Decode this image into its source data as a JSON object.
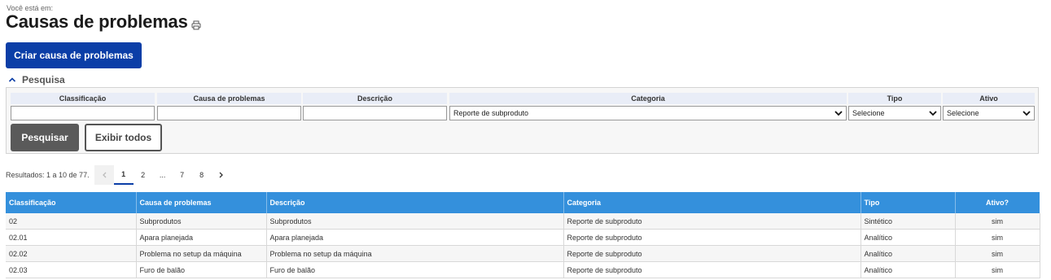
{
  "breadcrumb": {
    "label": "Você está em:"
  },
  "page": {
    "title": "Causas de problemas"
  },
  "actions": {
    "create_label": "Criar causa de problemas"
  },
  "search": {
    "title": "Pesquisa",
    "columns": [
      {
        "label": "Classificação",
        "value": ""
      },
      {
        "label": "Causa de problemas",
        "value": ""
      },
      {
        "label": "Descrição",
        "value": ""
      },
      {
        "label": "Categoria",
        "value": "Reporte de subproduto"
      },
      {
        "label": "Tipo",
        "value": "Selecione"
      },
      {
        "label": "Ativo",
        "value": "Selecione"
      }
    ],
    "search_label": "Pesquisar",
    "show_all_label": "Exibir todos"
  },
  "results": {
    "summary": "Resultados: 1 a 10 de 77.",
    "pages": [
      "1",
      "2",
      "...",
      "7",
      "8"
    ],
    "active_page": "1"
  },
  "table": {
    "headers": [
      "Classificação",
      "Causa de problemas",
      "Descrição",
      "Categoria",
      "Tipo",
      "Ativo?"
    ],
    "rows": [
      [
        "02",
        "Subprodutos",
        "Subprodutos",
        "Reporte de subproduto",
        "Sintético",
        "sim"
      ],
      [
        "02.01",
        "Apara planejada",
        "Apara planejada",
        "Reporte de subproduto",
        "Analítico",
        "sim"
      ],
      [
        "02.02",
        "Problema no setup da máquina",
        "Problema no setup da máquina",
        "Reporte de subproduto",
        "Analítico",
        "sim"
      ],
      [
        "02.03",
        "Furo de balão",
        "Furo de balão",
        "Reporte de subproduto",
        "Analítico",
        "sim"
      ]
    ]
  },
  "icons": {
    "print": "printer-icon",
    "collapse": "chevron-up-icon",
    "select": "chevron-down-icon",
    "prev": "chevron-left-icon",
    "next": "chevron-right-icon"
  },
  "colors": {
    "primary": "#0b3ea7",
    "table_header": "#3490dc",
    "search_button": "#5a5a5a"
  }
}
